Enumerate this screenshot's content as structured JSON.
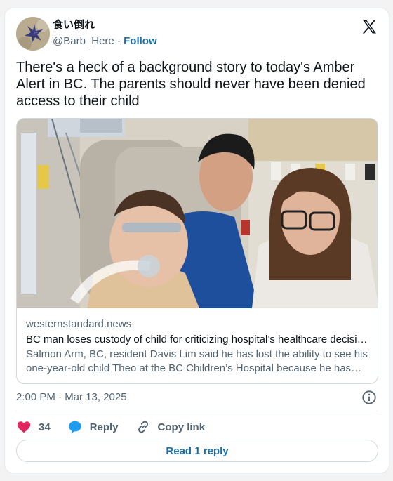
{
  "author": {
    "display_name": "食い倒れ",
    "handle": "@Barb_Here",
    "separator": "·",
    "follow_label": "Follow"
  },
  "tweet": {
    "text": "There's a heck of a background story to today's Amber Alert in BC. The parents should never have been denied access to their child"
  },
  "link_card": {
    "domain": "westernstandard.news",
    "title": "BC man loses custody of child for criticizing hospital’s healthcare decisions",
    "description": "Salmon Arm, BC, resident Davis Lim said he has lost the ability to see his one-year-old child Theo at the BC Children’s Hospital because he has criticized the hospital’s healthcare decisions"
  },
  "timestamp": "2:00 PM · Mar 13, 2025",
  "actions": {
    "like_count": "34",
    "reply_label": "Reply",
    "copy_link_label": "Copy link"
  },
  "read_reply_label": "Read 1 reply",
  "icons": [
    "x-logo-icon",
    "info-icon",
    "heart-icon",
    "reply-bubble-icon",
    "link-icon"
  ],
  "colors": {
    "link_blue": "#1d6fa8",
    "heart_pink": "#e0245e",
    "reply_blue": "#1d9bf0",
    "muted_text": "#536471"
  }
}
